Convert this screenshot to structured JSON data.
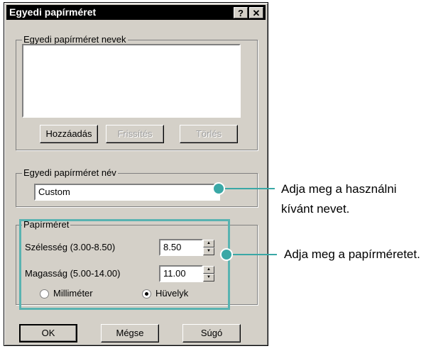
{
  "window": {
    "title": "Egyedi papírméret",
    "help_button": "?",
    "close_button": "✕"
  },
  "names_group": {
    "label": "Egyedi papírméret nevek",
    "add_button": "Hozzáadás",
    "refresh_button": "Frissítés",
    "delete_button": "Törlés"
  },
  "name_group": {
    "label": "Egyedi papírméret név",
    "name_value": "Custom"
  },
  "size_group": {
    "label": "Papírméret",
    "width_label": "Szélesség (3.00-8.50)",
    "width_value": "8.50",
    "height_label": "Magasság (5.00-14.00)",
    "height_value": "11.00",
    "unit_mm": "Milliméter",
    "unit_inch": "Hüvelyk",
    "selected_unit": "Hüvelyk"
  },
  "buttons": {
    "ok": "OK",
    "cancel": "Mégse",
    "help": "Súgó"
  },
  "annotations": {
    "name_line1": "Adja meg a használni",
    "name_line2": "kívánt nevet.",
    "size": "Adja meg a papírméretet."
  },
  "colors": {
    "highlight": "#3aa8a6",
    "dialog_bg": "#d4d0c8",
    "titlebar_bg": "#000000"
  }
}
